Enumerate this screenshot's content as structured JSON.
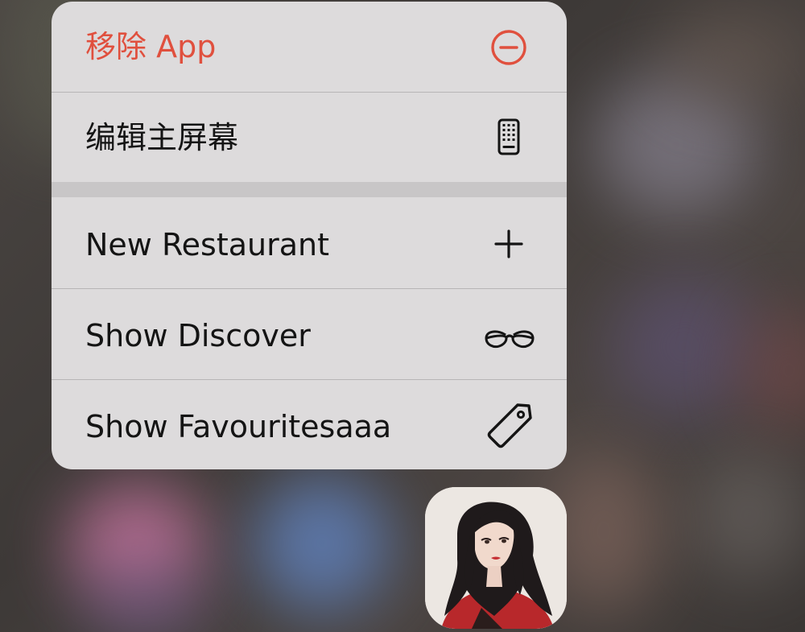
{
  "menu": {
    "items": [
      {
        "label": "移除 App",
        "icon": "minus-circle-icon",
        "style": "destructive"
      },
      {
        "label": "编辑主屏幕",
        "icon": "phone-grid-icon",
        "style": "default"
      },
      {
        "label": "New Restaurant",
        "icon": "plus-icon",
        "style": "default"
      },
      {
        "label": "Show Discover",
        "icon": "glasses-icon",
        "style": "default"
      },
      {
        "label": "Show Favouritesaaa",
        "icon": "tag-icon",
        "style": "default"
      }
    ]
  },
  "colors": {
    "destructive": "#e0503e",
    "menu_background": "#dddbdc",
    "text": "#141414"
  },
  "app_icon": {
    "icon": "app-icon-portrait"
  }
}
